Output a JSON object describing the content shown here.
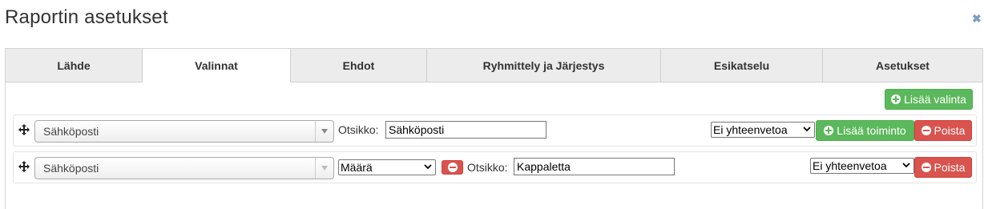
{
  "dialog": {
    "title": "Raportin asetukset",
    "close_icon": "close-icon"
  },
  "tabs": [
    {
      "label": "Lähde"
    },
    {
      "label": "Valinnat",
      "active": true
    },
    {
      "label": "Ehdot"
    },
    {
      "label": "Ryhmittely ja Järjestys"
    },
    {
      "label": "Esikatselu"
    },
    {
      "label": "Asetukset"
    }
  ],
  "toolbar": {
    "add_selection_label": "Lisää valinta"
  },
  "rows": [
    {
      "field": "Sähköposti",
      "title_label": "Otsikko:",
      "title_value": "Sähköposti",
      "summary": "Ei yhteenvetoa",
      "add_action_label": "Lisää toiminto",
      "remove_label": "Poista"
    },
    {
      "field": "Sähköposti",
      "function": "Määrä",
      "title_label": "Otsikko:",
      "title_value": "Kappaletta",
      "summary": "Ei yhteenvetoa",
      "remove_label": "Poista"
    }
  ],
  "colors": {
    "success": "#5cb85c",
    "danger": "#d9534f",
    "tab_bg": "#ececec"
  }
}
